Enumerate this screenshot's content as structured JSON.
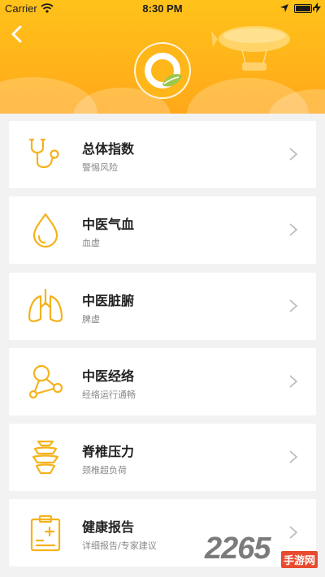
{
  "status_bar": {
    "carrier": "Carrier",
    "time": "8:30 PM"
  },
  "header": {
    "logo_icon": "tcm-leaf-logo-icon",
    "accent": "#ffb619"
  },
  "items": [
    {
      "title": "总体指数",
      "subtitle": "警惕风险",
      "icon": "stethoscope-icon"
    },
    {
      "title": "中医气血",
      "subtitle": "血虚",
      "icon": "blood-drop-icon"
    },
    {
      "title": "中医脏腑",
      "subtitle": "脾虚",
      "icon": "lungs-icon"
    },
    {
      "title": "中医经络",
      "subtitle": "经络运行通畅",
      "icon": "meridian-nodes-icon"
    },
    {
      "title": "脊椎压力",
      "subtitle": "颈椎超负荷",
      "icon": "spine-icon"
    },
    {
      "title": "健康报告",
      "subtitle": "详细报告/专家建议",
      "icon": "report-clipboard-icon"
    }
  ],
  "watermark": {
    "number": "2265",
    "site": "手游网"
  }
}
